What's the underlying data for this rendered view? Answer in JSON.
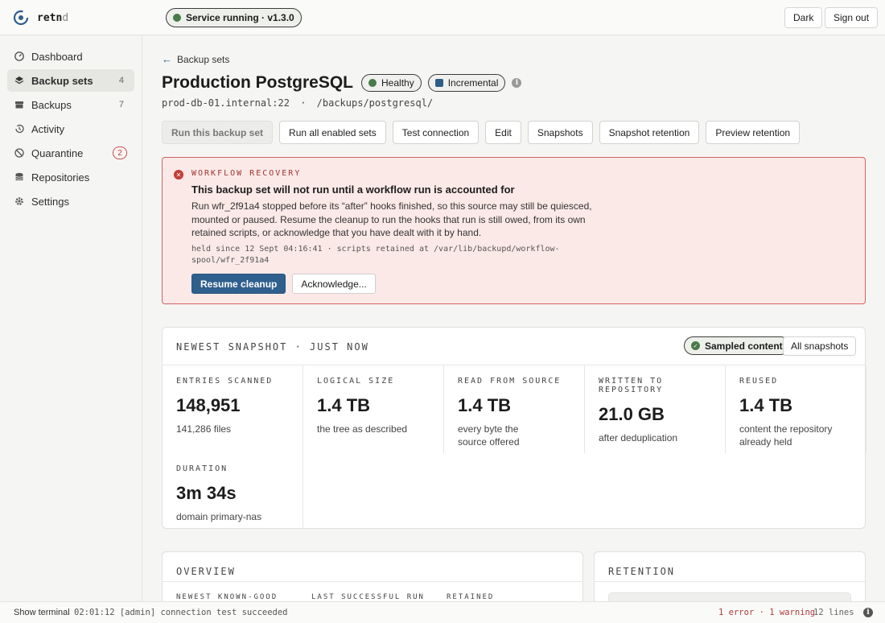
{
  "app": {
    "name_main": "retn",
    "name_dim": "d"
  },
  "header": {
    "service_status": "Service running · v1.3.0",
    "theme_button": "Dark",
    "signout_button": "Sign out"
  },
  "sidebar": {
    "items": [
      {
        "label": "Dashboard",
        "icon": "dashboard-icon"
      },
      {
        "label": "Backup sets",
        "icon": "layers-icon",
        "count": "4",
        "active": true
      },
      {
        "label": "Backups",
        "icon": "archive-icon",
        "count": "7"
      },
      {
        "label": "Activity",
        "icon": "history-icon"
      },
      {
        "label": "Quarantine",
        "icon": "block-icon",
        "badge": "2"
      },
      {
        "label": "Repositories",
        "icon": "database-icon"
      },
      {
        "label": "Settings",
        "icon": "gear-icon"
      }
    ]
  },
  "page": {
    "back_label": "Backup sets",
    "title": "Production PostgreSQL",
    "status_pill": "Healthy",
    "mode_pill": "Incremental",
    "host": "prod-db-01.internal:22",
    "separator": "·",
    "path": "/backups/postgresql/",
    "actions": [
      "Run this backup set",
      "Run all enabled sets",
      "Test connection",
      "Edit",
      "Snapshots",
      "Snapshot retention",
      "Preview retention"
    ]
  },
  "alert": {
    "kicker": "WORKFLOW RECOVERY",
    "title": "This backup set will not run until a workflow run is accounted for",
    "body": "Run wfr_2f91a4 stopped before its “after” hooks finished, so this source may still be quiesced, mounted or paused. Resume the cleanup to run the hooks that run is still owed, from its own retained scripts, or acknowledge that you have dealt with it by hand.",
    "meta": "held since 12 Sept 04:16:41 · scripts retained at /var/lib/backupd/workflow-spool/wfr_2f91a4",
    "primary_button": "Resume cleanup",
    "secondary_button": "Acknowledge..."
  },
  "snapshot": {
    "heading": "NEWEST SNAPSHOT · JUST NOW",
    "sampled_pill": "Sampled content",
    "all_button": "All snapshots",
    "metrics": [
      {
        "label": "ENTRIES SCANNED",
        "value": "148,951",
        "sub": "141,286 files"
      },
      {
        "label": "LOGICAL SIZE",
        "value": "1.4 TB",
        "sub": "the tree as described"
      },
      {
        "label": "READ FROM SOURCE",
        "value": "1.4 TB",
        "sub": "every byte the source offered"
      },
      {
        "label": "WRITTEN TO REPOSITORY",
        "value": "21.0 GB",
        "sub": "after deduplication"
      },
      {
        "label": "REUSED",
        "value": "1.4 TB",
        "sub": "content the repository already held"
      },
      {
        "label": "DURATION",
        "value": "3m 34s",
        "sub": "domain primary-nas"
      }
    ]
  },
  "overview": {
    "heading": "OVERVIEW",
    "labels": [
      "NEWEST KNOWN-GOOD",
      "LAST SUCCESSFUL RUN",
      "RETAINED"
    ]
  },
  "retention": {
    "heading": "RETENTION"
  },
  "statusbar": {
    "terminal": "Show terminal",
    "log": "02:01:12 [admin] connection test succeeded",
    "errors": "1 error · 1 warning",
    "lines": "12 lines"
  },
  "colors": {
    "accent": "#2f5f8d",
    "healthy": "#4a7a4a",
    "error": "#c23b37",
    "alert_bg": "#fbe9e7"
  }
}
